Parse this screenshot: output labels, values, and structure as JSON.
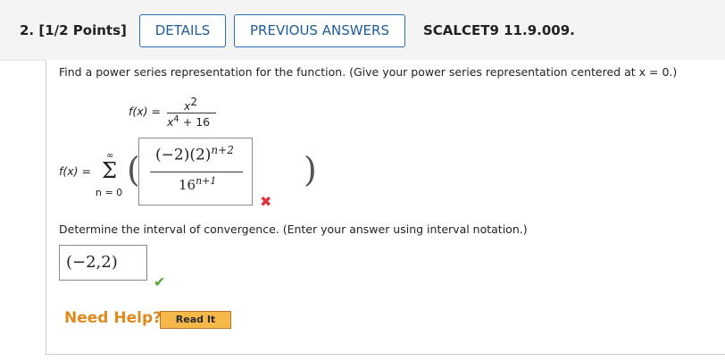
{
  "question": {
    "number_label": "2. [1/2 Points]",
    "details_label": "DETAILS",
    "previous_answers_label": "PREVIOUS ANSWERS",
    "code": "SCALCET9 11.9.009."
  },
  "problem": {
    "instruction": "Find a power series representation for the function. (Give your power series representation centered at x = 0.)",
    "function": {
      "lhs": "f(x) =",
      "numerator_base": "x",
      "numerator_exp": "2",
      "denominator_base": "x",
      "denominator_exp": "4",
      "denominator_tail": "+ 16"
    },
    "series": {
      "lhs": "f(x) =",
      "sum_upper": "∞",
      "sum_symbol": "Σ",
      "sum_lower": "n = 0",
      "answer_numerator_base": "(−2)(2)",
      "answer_numerator_exp": "n+2",
      "answer_denominator_base": "16",
      "answer_denominator_exp": "n+1",
      "result": "incorrect"
    },
    "interval_prompt": "Determine the interval of convergence. (Enter your answer using interval notation.)",
    "interval_answer": "(−2,2)",
    "interval_result": "correct"
  },
  "help": {
    "label": "Need Help?",
    "read_it_label": "Read It"
  },
  "colors": {
    "accent": "#2a6db0",
    "incorrect": "#e0353b",
    "correct": "#5aa832",
    "help": "#e08a1e",
    "read_it_bg": "#f7b84a"
  }
}
